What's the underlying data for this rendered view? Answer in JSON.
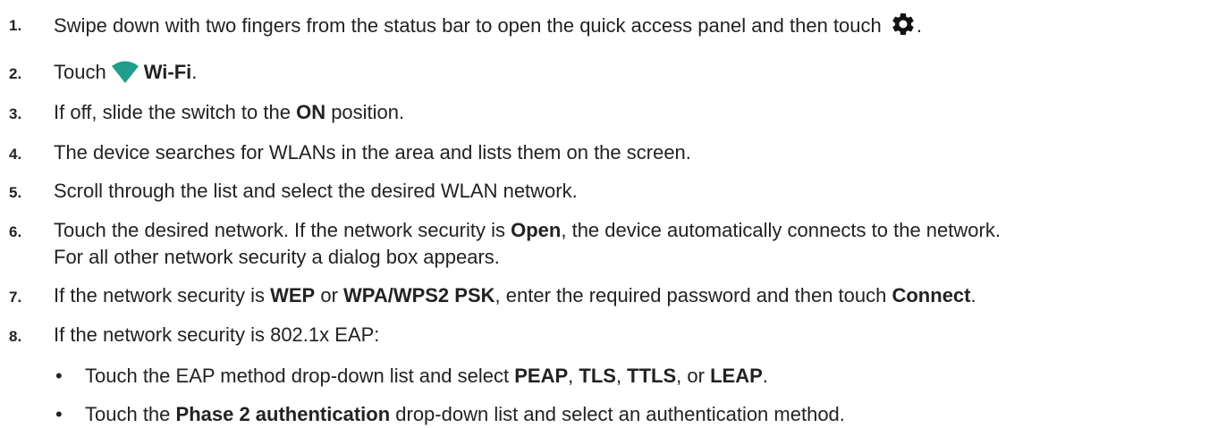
{
  "steps": [
    {
      "num": "1.",
      "a": "Swipe down with two fingers from the status bar to open the quick access panel and then touch ",
      "icon": "gear-icon",
      "b": "."
    },
    {
      "num": "2.",
      "a": "Touch",
      "icon": "wifi-icon",
      "bold1": "Wi-Fi",
      "b": "."
    },
    {
      "num": "3.",
      "a": "If off, slide the switch to the ",
      "bold1": "ON",
      "b": " position."
    },
    {
      "num": "4.",
      "a": "The device searches for WLANs in the area and lists them on the screen."
    },
    {
      "num": "5.",
      "a": "Scroll through the list and select the desired WLAN network."
    },
    {
      "num": "6.",
      "a": "Touch the desired network. If the network security is ",
      "bold1": "Open",
      "b": ", the device automatically connects to the network.",
      "cont": "For all other network security a dialog box appears."
    },
    {
      "num": "7.",
      "a": "If the network security is ",
      "bold1": "WEP",
      "b": " or ",
      "bold2": "WPA/WPS2 PSK",
      "c": ", enter the required password and then touch ",
      "bold3": "Connect",
      "d": "."
    },
    {
      "num": "8.",
      "a": "If the network security is 802.1x EAP:"
    }
  ],
  "bullets": [
    {
      "symbol": "•",
      "a": "Touch the EAP method drop-down list and select ",
      "bold1": "PEAP",
      "b": ", ",
      "bold2": "TLS",
      "c": ", ",
      "bold3": "TTLS",
      "d": ", or ",
      "bold4": "LEAP",
      "e": "."
    },
    {
      "symbol": "•",
      "a": "Touch the ",
      "bold1": "Phase 2 authentication",
      "b": " drop-down list and select an authentication method."
    }
  ],
  "colors": {
    "text": "#222222",
    "wifi_icon": "#1f9e8c",
    "gear_icon": "#111111"
  }
}
